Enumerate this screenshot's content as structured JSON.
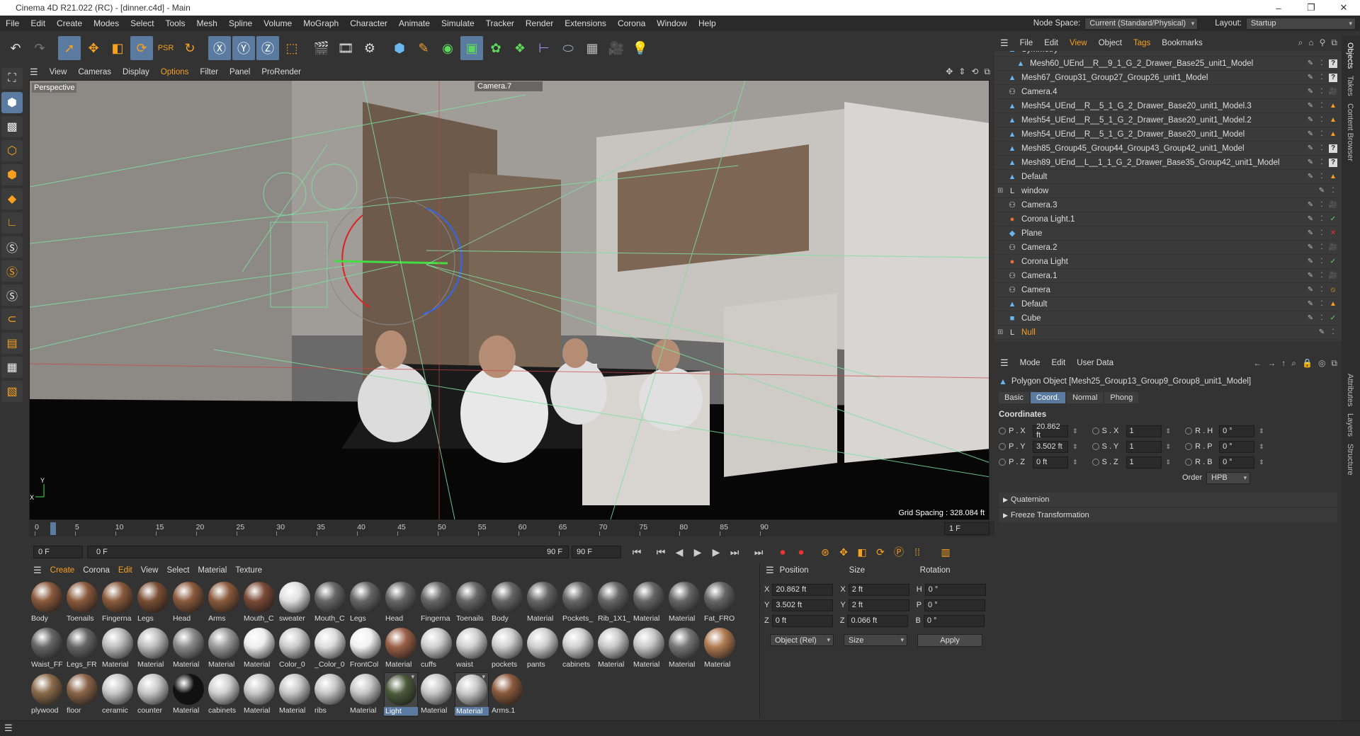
{
  "app": {
    "title": "Cinema 4D R21.022 (RC) - [dinner.c4d] - Main"
  },
  "menubar": {
    "items": [
      "File",
      "Edit",
      "Create",
      "Modes",
      "Select",
      "Tools",
      "Mesh",
      "Spline",
      "Volume",
      "MoGraph",
      "Character",
      "Animate",
      "Simulate",
      "Tracker",
      "Render",
      "Extensions",
      "Corona",
      "Window",
      "Help"
    ],
    "node_space_label": "Node Space:",
    "node_space_value": "Current (Standard/Physical)",
    "layout_label": "Layout:",
    "layout_value": "Startup"
  },
  "viewport": {
    "menu": [
      "View",
      "Cameras",
      "Display",
      "Options",
      "Filter",
      "Panel",
      "ProRender"
    ],
    "name": "Perspective",
    "camera": "Camera.7",
    "grid_spacing": "Grid Spacing : 328.084 ft"
  },
  "timeline": {
    "ticks": [
      "0",
      "5",
      "10",
      "15",
      "20",
      "25",
      "30",
      "35",
      "40",
      "45",
      "50",
      "55",
      "60",
      "65",
      "70",
      "75",
      "80",
      "85",
      "90"
    ],
    "current_frame_field": "1 F",
    "start": "0 F",
    "current": "0 F",
    "end_in": "90 F",
    "end": "90 F"
  },
  "materials": {
    "menu": [
      "Create",
      "Corona",
      "Edit",
      "View",
      "Select",
      "Material",
      "Texture"
    ],
    "items": [
      {
        "name": "Body",
        "color": "#8a5a3c"
      },
      {
        "name": "Toenails",
        "color": "#8a5a3c"
      },
      {
        "name": "Fingerna",
        "color": "#8a5a3c"
      },
      {
        "name": "Legs",
        "color": "#7a4e34"
      },
      {
        "name": "Head",
        "color": "#8a5a3c"
      },
      {
        "name": "Arms",
        "color": "#8a5a3c"
      },
      {
        "name": "Mouth_C",
        "color": "#7a4a36"
      },
      {
        "name": "sweater",
        "color": "#e0e0e0"
      },
      {
        "name": "Mouth_C",
        "color": "#666666"
      },
      {
        "name": "Legs",
        "color": "#666666"
      },
      {
        "name": "Head",
        "color": "#666666"
      },
      {
        "name": "Fingerna",
        "color": "#666666"
      },
      {
        "name": "Toenails",
        "color": "#666666"
      },
      {
        "name": "Body",
        "color": "#666666"
      },
      {
        "name": "Material",
        "color": "#666666"
      },
      {
        "name": "Pockets_",
        "color": "#666666"
      },
      {
        "name": "Rib_1X1_",
        "color": "#666666"
      },
      {
        "name": "Material",
        "color": "#666666"
      },
      {
        "name": "Material",
        "color": "#666666"
      },
      {
        "name": "Fat_FRO",
        "color": "#666666"
      },
      {
        "name": "Waist_FF",
        "color": "#666666"
      },
      {
        "name": "Legs_FR",
        "color": "#666666"
      },
      {
        "name": "Material",
        "color": "#bdbdbd"
      },
      {
        "name": "Material",
        "color": "#bdbdbd"
      },
      {
        "name": "Material",
        "color": "#8a8a8a"
      },
      {
        "name": "Material",
        "color": "#9a9a9a"
      },
      {
        "name": "Material",
        "color": "#eeeeee"
      },
      {
        "name": "Color_0",
        "color": "#cccccc"
      },
      {
        "name": "_Color_0",
        "color": "#dddddd"
      },
      {
        "name": "FrontCol",
        "color": "#f2f2f2"
      },
      {
        "name": "Material",
        "color": "#9a6046"
      },
      {
        "name": "cuffs",
        "color": "#cfcfcf"
      },
      {
        "name": "waist",
        "color": "#cfcfcf"
      },
      {
        "name": "pockets",
        "color": "#cfcfcf"
      },
      {
        "name": "pants",
        "color": "#cfcfcf"
      },
      {
        "name": "cabinets",
        "color": "#d0d0d0"
      },
      {
        "name": "Material",
        "color": "#c8c8c8"
      },
      {
        "name": "Material",
        "color": "#c8c8c8"
      },
      {
        "name": "Material",
        "color": "#777777"
      },
      {
        "name": "Material",
        "color": "#b07a52"
      },
      {
        "name": "plywood",
        "color": "#8a6a4a"
      },
      {
        "name": "floor",
        "color": "#8a6448"
      },
      {
        "name": "ceramic",
        "color": "#c8c8c8"
      },
      {
        "name": "counter",
        "color": "#c8c8c8"
      },
      {
        "name": "Material",
        "color": "#111111"
      },
      {
        "name": "cabinets",
        "color": "#d0d0d0"
      },
      {
        "name": "Material",
        "color": "#c8c8c8"
      },
      {
        "name": "Material",
        "color": "#c8c8c8"
      },
      {
        "name": "ribs",
        "color": "#c8c8c8"
      },
      {
        "name": "Material",
        "color": "#c8c8c8"
      },
      {
        "name": "Light",
        "color": "#4a5a3a",
        "selected": true
      },
      {
        "name": "Material",
        "color": "#c8c8c8"
      },
      {
        "name": "Material",
        "color": "#c8c8c8",
        "selected": true
      },
      {
        "name": "Arms.1",
        "color": "#8a5a3c"
      }
    ]
  },
  "coords": {
    "headers": [
      "Position",
      "Size",
      "Rotation"
    ],
    "rows": [
      {
        "axis": "X",
        "pos": "20.862 ft",
        "size": "2 ft",
        "rot_label": "H",
        "rot": "0 °"
      },
      {
        "axis": "Y",
        "pos": "3.502 ft",
        "size": "2 ft",
        "rot_label": "P",
        "rot": "0 °"
      },
      {
        "axis": "Z",
        "pos": "0 ft",
        "size": "0.066 ft",
        "rot_label": "B",
        "rot": "0 °"
      }
    ],
    "mode": "Object (Rel)",
    "size_mode": "Size",
    "apply": "Apply"
  },
  "objects": {
    "menu": [
      "File",
      "Edit",
      "View",
      "Object",
      "Tags",
      "Bookmarks"
    ],
    "items": [
      {
        "name": "Symmetry",
        "icon": "▲"
      },
      {
        "name": "Mesh60_UEnd__R__9_1_G_2_Drawer_Base25_unit1_Model",
        "icon": "▲",
        "tag": "?",
        "indent": true
      },
      {
        "name": "Mesh67_Group31_Group27_Group26_unit1_Model",
        "icon": "▲",
        "tag": "?"
      },
      {
        "name": "Camera.4",
        "icon": "⚇",
        "tag": "🎥"
      },
      {
        "name": "Mesh54_UEnd__R__5_1_G_2_Drawer_Base20_unit1_Model.3",
        "icon": "▲",
        "tag": "▲"
      },
      {
        "name": "Mesh54_UEnd__R__5_1_G_2_Drawer_Base20_unit1_Model.2",
        "icon": "▲",
        "tag": "▲"
      },
      {
        "name": "Mesh54_UEnd__R__5_1_G_2_Drawer_Base20_unit1_Model",
        "icon": "▲",
        "tag": "▲"
      },
      {
        "name": "Mesh85_Group45_Group44_Group43_Group42_unit1_Model",
        "icon": "▲",
        "tag": "?"
      },
      {
        "name": "Mesh89_UEnd__L__1_1_G_2_Drawer_Base35_Group42_unit1_Model",
        "icon": "▲",
        "tag": "?"
      },
      {
        "name": "Default",
        "icon": "▲",
        "tag": "▲"
      },
      {
        "name": "window",
        "icon": "L"
      },
      {
        "name": "Camera.3",
        "icon": "⚇",
        "tag": "🎥"
      },
      {
        "name": "Corona Light.1",
        "icon": "●",
        "tag": "✓"
      },
      {
        "name": "Plane",
        "icon": "◆",
        "tag": "✕"
      },
      {
        "name": "Camera.2",
        "icon": "⚇",
        "tag": "🎥"
      },
      {
        "name": "Corona Light",
        "icon": "●",
        "tag": "✓"
      },
      {
        "name": "Camera.1",
        "icon": "⚇",
        "tag": "🎥"
      },
      {
        "name": "Camera",
        "icon": "⚇",
        "tag": "⦸"
      },
      {
        "name": "Default",
        "icon": "▲",
        "tag": "▲"
      },
      {
        "name": "Cube",
        "icon": "■",
        "tag": "✓"
      },
      {
        "name": "Null",
        "icon": "L",
        "orange": true
      }
    ]
  },
  "attributes": {
    "menu": [
      "Mode",
      "Edit",
      "User Data"
    ],
    "object": "Polygon Object [Mesh25_Group13_Group9_Group8_unit1_Model]",
    "tabs": [
      "Basic",
      "Coord.",
      "Normal",
      "Phong"
    ],
    "section": "Coordinates",
    "rows": [
      {
        "p": "P . X",
        "pv": "20.862 ft",
        "s": "S . X",
        "sv": "1",
        "r": "R . H",
        "rv": "0 °"
      },
      {
        "p": "P . Y",
        "pv": "3.502 ft",
        "s": "S . Y",
        "sv": "1",
        "r": "R . P",
        "rv": "0 °"
      },
      {
        "p": "P . Z",
        "pv": "0 ft",
        "s": "S . Z",
        "sv": "1",
        "r": "R . B",
        "rv": "0 °"
      }
    ],
    "order_label": "Order",
    "order_value": "HPB",
    "quaternion": "Quaternion",
    "freeze": "Freeze Transformation"
  },
  "side_tabs": [
    "Objects",
    "Takes",
    "Content Browser",
    "Attributes",
    "Layers",
    "Structure"
  ]
}
